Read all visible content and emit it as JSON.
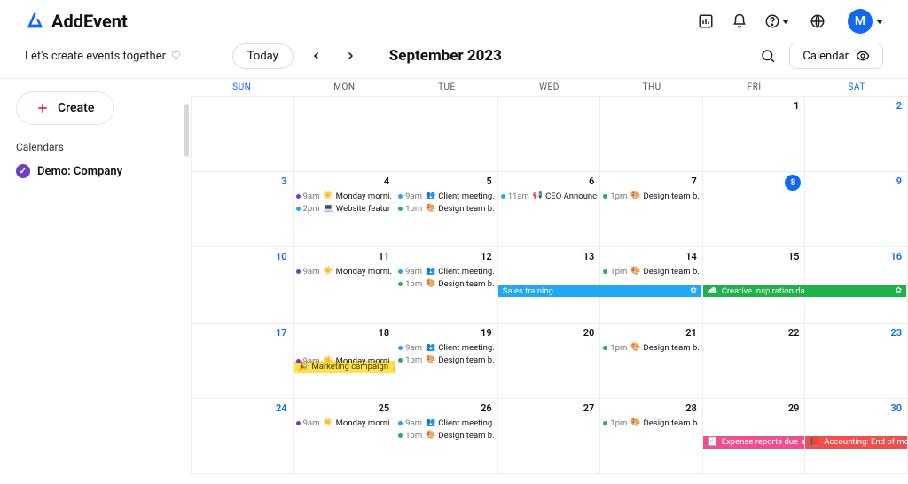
{
  "brand": {
    "name": "AddEvent",
    "avatar_initial": "M"
  },
  "toolbar": {
    "tagline": "Let's create events together",
    "today_label": "Today",
    "month_title": "September 2023",
    "view_label": "Calendar"
  },
  "sidebar": {
    "create_label": "Create",
    "section_label": "Calendars",
    "calendars": [
      {
        "name": "Demo: Company",
        "checked": true
      }
    ]
  },
  "cal_header": {
    "days": [
      "SUN",
      "MON",
      "TUE",
      "WED",
      "THU",
      "FRI",
      "SAT"
    ]
  },
  "weeks": [
    [
      {
        "n": "",
        "wknd": true,
        "events": []
      },
      {
        "n": "",
        "events": []
      },
      {
        "n": "",
        "events": []
      },
      {
        "n": "",
        "events": []
      },
      {
        "n": "",
        "events": []
      },
      {
        "n": "1",
        "events": []
      },
      {
        "n": "2",
        "wknd": true,
        "events": []
      }
    ],
    [
      {
        "n": "3",
        "wknd": true,
        "events": []
      },
      {
        "n": "4",
        "events": [
          {
            "k": "e",
            "color": "d-purple",
            "time": "9am",
            "emoji": "☀️",
            "title": "Monday morni."
          },
          {
            "k": "e",
            "color": "d-blue",
            "time": "2pm",
            "emoji": "💻",
            "title": "Website featur"
          }
        ]
      },
      {
        "n": "5",
        "events": [
          {
            "k": "e",
            "color": "d-blue",
            "time": "9am",
            "emoji": "👥",
            "title": "Client meeting."
          },
          {
            "k": "e",
            "color": "d-green",
            "time": "1pm",
            "emoji": "🎨",
            "title": "Design team b."
          }
        ]
      },
      {
        "n": "6",
        "events": [
          {
            "k": "e",
            "color": "d-blue",
            "time": "11am",
            "emoji": "📢",
            "title": "CEO Announc"
          }
        ]
      },
      {
        "n": "7",
        "events": [
          {
            "k": "e",
            "color": "d-green",
            "time": "1pm",
            "emoji": "🎨",
            "title": "Design team b."
          }
        ]
      },
      {
        "n": "8",
        "today": true,
        "events": []
      },
      {
        "n": "9",
        "wknd": true,
        "events": []
      }
    ],
    [
      {
        "n": "10",
        "wknd": true,
        "events": []
      },
      {
        "n": "11",
        "events": [
          {
            "k": "e",
            "color": "d-purple",
            "time": "9am",
            "emoji": "☀️",
            "title": "Monday morni."
          }
        ]
      },
      {
        "n": "12",
        "events": [
          {
            "k": "e",
            "color": "d-blue",
            "time": "9am",
            "emoji": "👥",
            "title": "Client meeting."
          },
          {
            "k": "e",
            "color": "d-green",
            "time": "1pm",
            "emoji": "🎨",
            "title": "Design team b."
          }
        ]
      },
      {
        "n": "13",
        "events": [
          {
            "k": "bar",
            "barclass": "bar-blue",
            "span": 2,
            "emoji": "",
            "title": "Sales training",
            "endico": "✿"
          }
        ]
      },
      {
        "n": "14",
        "barcont": true,
        "events": [
          {
            "k": "e",
            "color": "d-green",
            "time": "1pm",
            "emoji": "🎨",
            "title": "Design team b."
          }
        ]
      },
      {
        "n": "15",
        "events": [
          {
            "k": "bar",
            "barclass": "bar-green",
            "span": 2,
            "emoji": "☁️",
            "title": "Creative inspiration da",
            "endico": "✿"
          }
        ]
      },
      {
        "n": "16",
        "wknd": true,
        "barcont": true,
        "events": []
      }
    ],
    [
      {
        "n": "17",
        "wknd": true,
        "events": []
      },
      {
        "n": "18",
        "events": [
          {
            "k": "bar",
            "barclass": "bar-yellow",
            "span": 1,
            "emoji": "🎉",
            "title": "Marketing campaign",
            "endico": "🎉"
          },
          {
            "k": "e",
            "color": "d-purple",
            "time": "9am",
            "emoji": "☀️",
            "title": "Monday morni."
          }
        ]
      },
      {
        "n": "19",
        "events": [
          {
            "k": "e",
            "color": "d-blue",
            "time": "9am",
            "emoji": "👥",
            "title": "Client meeting."
          },
          {
            "k": "e",
            "color": "d-green",
            "time": "1pm",
            "emoji": "🎨",
            "title": "Design team b."
          }
        ]
      },
      {
        "n": "20",
        "events": []
      },
      {
        "n": "21",
        "events": [
          {
            "k": "e",
            "color": "d-green",
            "time": "1pm",
            "emoji": "🎨",
            "title": "Design team b."
          }
        ]
      },
      {
        "n": "22",
        "events": []
      },
      {
        "n": "23",
        "wknd": true,
        "events": []
      }
    ],
    [
      {
        "n": "24",
        "wknd": true,
        "events": []
      },
      {
        "n": "25",
        "events": [
          {
            "k": "e",
            "color": "d-purple",
            "time": "9am",
            "emoji": "☀️",
            "title": "Monday morni."
          }
        ]
      },
      {
        "n": "26",
        "events": [
          {
            "k": "e",
            "color": "d-blue",
            "time": "9am",
            "emoji": "👥",
            "title": "Client meeting."
          },
          {
            "k": "e",
            "color": "d-green",
            "time": "1pm",
            "emoji": "🎨",
            "title": "Design team b."
          }
        ]
      },
      {
        "n": "27",
        "events": []
      },
      {
        "n": "28",
        "events": [
          {
            "k": "e",
            "color": "d-green",
            "time": "1pm",
            "emoji": "🎨",
            "title": "Design team b."
          }
        ]
      },
      {
        "n": "29",
        "events": [
          {
            "k": "bar",
            "barclass": "bar-pink",
            "span": 1,
            "emoji": "🧾",
            "title": "Expense reports due",
            "endico": "✿"
          }
        ]
      },
      {
        "n": "30",
        "wknd": true,
        "events": [
          {
            "k": "bar",
            "barclass": "bar-red",
            "span": 1,
            "emoji": "📕",
            "title": "Accounting: End of mo",
            "endico": ""
          }
        ]
      }
    ]
  ]
}
